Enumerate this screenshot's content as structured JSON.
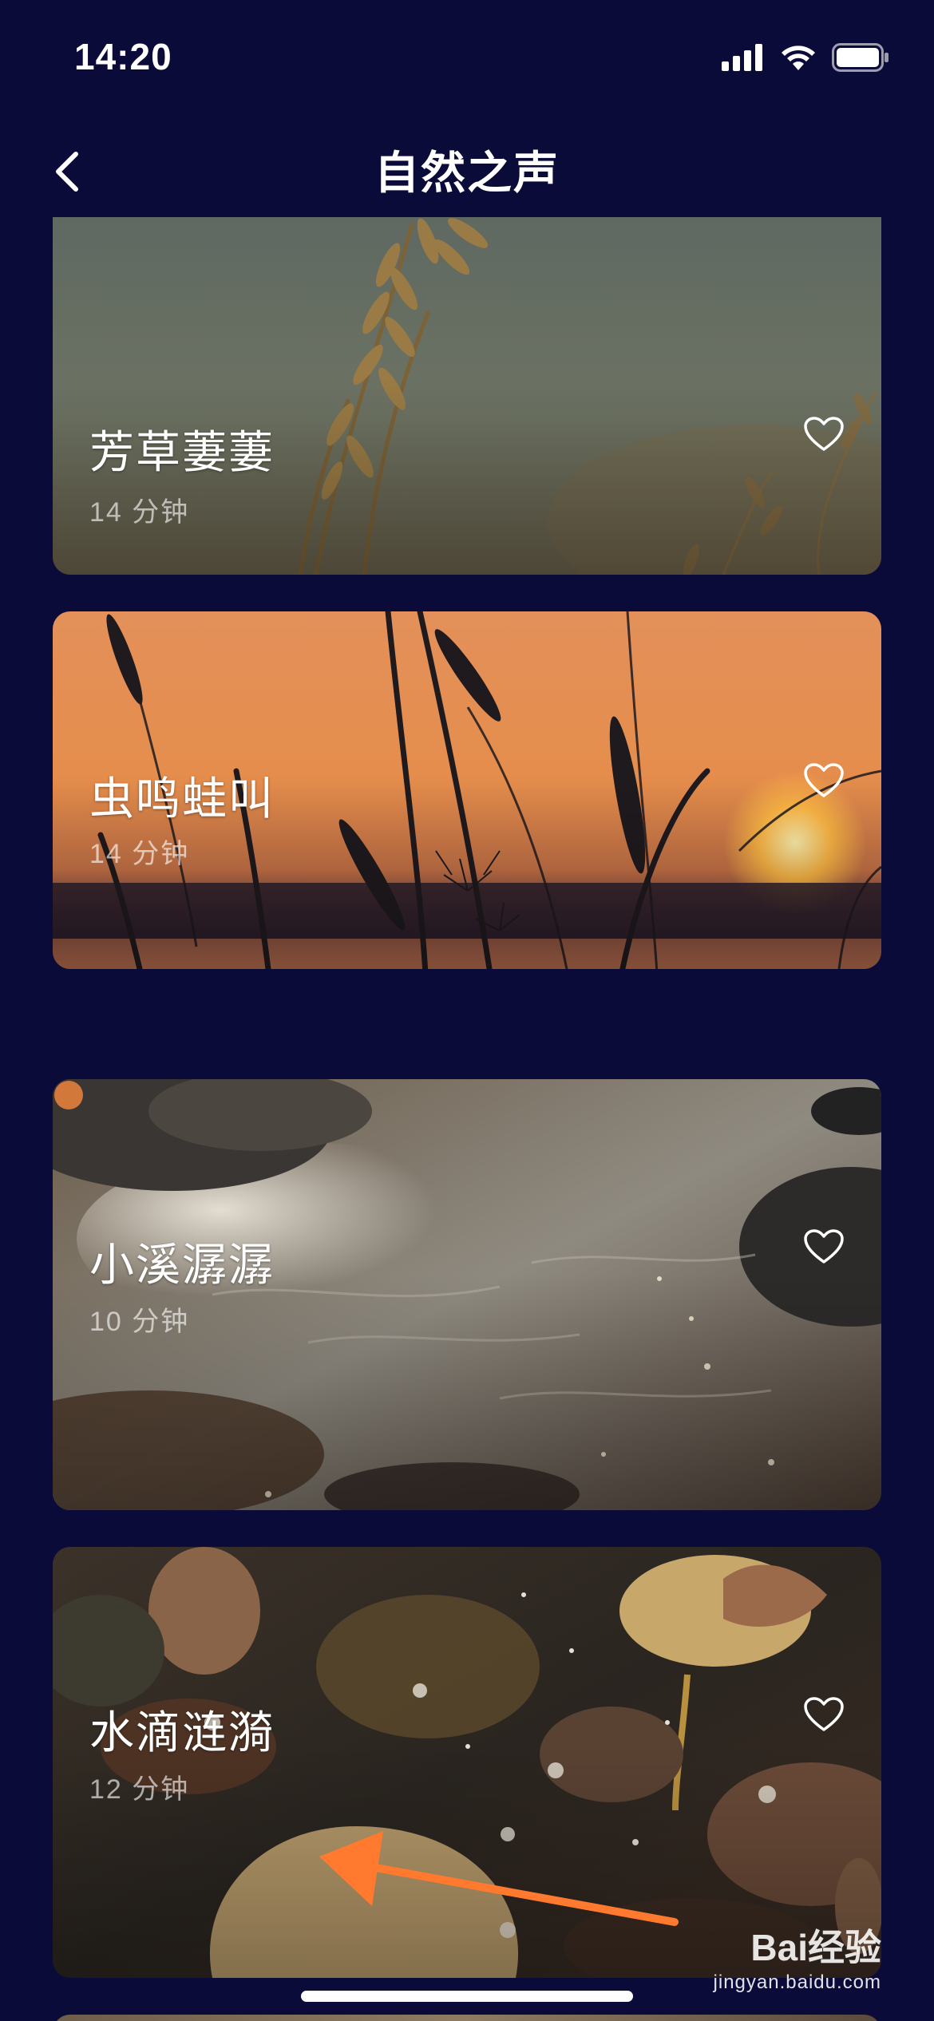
{
  "status_bar": {
    "time": "14:20"
  },
  "nav": {
    "title": "自然之声"
  },
  "cards": [
    {
      "title": "芳草萋萋",
      "duration": "14 分钟",
      "theme": "grass-field"
    },
    {
      "title": "虫鸣蛙叫",
      "duration": "14 分钟",
      "theme": "sunset-reeds"
    },
    {
      "title": "小溪潺潺",
      "duration": "10 分钟",
      "theme": "stream-water"
    },
    {
      "title": "水滴涟漪",
      "duration": "12 分钟",
      "theme": "leaves-in-water"
    }
  ],
  "watermark": {
    "brand": "Bai经验",
    "url": "jingyan.baidu.com"
  },
  "colors": {
    "background": "#0b0b3a",
    "text": "#ffffff",
    "annotation_arrow": "#ff7a2f"
  }
}
